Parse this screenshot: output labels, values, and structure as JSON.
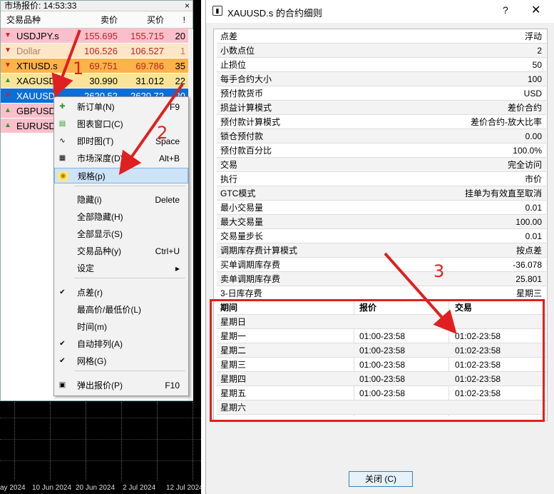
{
  "market_watch": {
    "title": "市场报价: 14:53:33",
    "close": "×",
    "headers": {
      "symbol": "交易品种",
      "bid": "卖价",
      "ask": "买价",
      "spread": "!"
    },
    "rows": [
      {
        "symbol": "USDJPY.s",
        "bid": "155.695",
        "ask": "155.715",
        "spread": "20",
        "bg": "#f9c0cc",
        "dir": "down"
      },
      {
        "symbol": "Dollar",
        "bid": "106.526",
        "ask": "106.527",
        "spread": "1",
        "bg": "#fde6c8",
        "dir": "down"
      },
      {
        "symbol": "XTIUSD.s",
        "bid": "69.751",
        "ask": "69.786",
        "spread": "35",
        "bg": "#fbb34a",
        "dir": "down"
      },
      {
        "symbol": "XAGUSD.s",
        "bid": "30.990",
        "ask": "31.012",
        "spread": "22",
        "bg": "#fce39a",
        "dir": "up"
      },
      {
        "symbol": "XAUUSD",
        "bid": "2620.52",
        "ask": "2620.72",
        "spread": "20",
        "bg": "#0b6fd6",
        "dir": "down"
      },
      {
        "symbol": "GBPUSD",
        "bid": "",
        "ask": "",
        "spread": "",
        "bg": "#f9c0cc",
        "dir": "up"
      },
      {
        "symbol": "EURUSD",
        "bid": "",
        "ask": "",
        "spread": "",
        "bg": "#f9c0cc",
        "dir": "up"
      }
    ]
  },
  "context_menu": {
    "items": [
      {
        "label": "新订单(N)",
        "shortcut": "F9",
        "icon": "new-order-icon"
      },
      {
        "label": "图表窗口(C)",
        "shortcut": "",
        "icon": "chart-window-icon"
      },
      {
        "label": "即时图(T)",
        "shortcut": "Space",
        "icon": "tick-chart-icon"
      },
      {
        "label": "市场深度(D)",
        "shortcut": "Alt+B",
        "icon": "depth-icon"
      },
      {
        "label": "规格(p)",
        "shortcut": "",
        "icon": "spec-icon"
      },
      {
        "label": "隐藏(i)",
        "shortcut": "Delete",
        "icon": ""
      },
      {
        "label": "全部隐藏(H)",
        "shortcut": "",
        "icon": ""
      },
      {
        "label": "全部显示(S)",
        "shortcut": "",
        "icon": ""
      },
      {
        "label": "交易品种(y)",
        "shortcut": "Ctrl+U",
        "icon": ""
      },
      {
        "label": "设定",
        "shortcut": "▸",
        "icon": ""
      },
      {
        "label": "点差(r)",
        "shortcut": "",
        "icon": "check-icon"
      },
      {
        "label": "最高价/最低价(L)",
        "shortcut": "",
        "icon": ""
      },
      {
        "label": "时间(m)",
        "shortcut": "",
        "icon": ""
      },
      {
        "label": "自动排列(A)",
        "shortcut": "",
        "icon": "check-icon"
      },
      {
        "label": "网格(G)",
        "shortcut": "",
        "icon": "check-icon"
      },
      {
        "label": "弹出报价(P)",
        "shortcut": "F10",
        "icon": "popup-icon"
      }
    ]
  },
  "chart_dates": [
    "ay 2024",
    "10 Jun 2024",
    "20 Jun 2024",
    "2 Jul 2024",
    "12 Jul 2024"
  ],
  "dialog": {
    "title": "XAUUSD.s 的合约细则",
    "help": "?",
    "close": "✕",
    "specs": [
      {
        "k": "点差",
        "v": "浮动"
      },
      {
        "k": "小数点位",
        "v": "2"
      },
      {
        "k": "止损位",
        "v": "50"
      },
      {
        "k": "每手合约大小",
        "v": "100"
      },
      {
        "k": "预付款货币",
        "v": "USD"
      },
      {
        "k": "损益计算模式",
        "v": "差价合约"
      },
      {
        "k": "预付款计算模式",
        "v": "差价合约-放大比率"
      },
      {
        "k": "锁仓预付款",
        "v": "0.00"
      },
      {
        "k": "预付款百分比",
        "v": "100.0%"
      },
      {
        "k": "交易",
        "v": "完全访问"
      },
      {
        "k": "执行",
        "v": "市价"
      },
      {
        "k": "GTC模式",
        "v": "挂单为有效直至取消"
      },
      {
        "k": "最小交易量",
        "v": "0.01"
      },
      {
        "k": "最大交易量",
        "v": "100.00"
      },
      {
        "k": "交易量步长",
        "v": "0.01"
      },
      {
        "k": "调期库存费计算模式",
        "v": "按点差"
      },
      {
        "k": "买单调期库存费",
        "v": "-36.078"
      },
      {
        "k": "卖单调期库存费",
        "v": "25.801"
      },
      {
        "k": "3-日库存费",
        "v": "星期三"
      }
    ],
    "schedule_headers": {
      "day": "期间",
      "quote": "报价",
      "trade": "交易"
    },
    "schedule": [
      {
        "day": "星期日",
        "quote": "",
        "trade": ""
      },
      {
        "day": "星期一",
        "quote": "01:00-23:58",
        "trade": "01:02-23:58"
      },
      {
        "day": "星期二",
        "quote": "01:00-23:58",
        "trade": "01:02-23:58"
      },
      {
        "day": "星期三",
        "quote": "01:00-23:58",
        "trade": "01:02-23:58"
      },
      {
        "day": "星期四",
        "quote": "01:00-23:58",
        "trade": "01:02-23:58"
      },
      {
        "day": "星期五",
        "quote": "01:00-23:58",
        "trade": "01:02-23:58"
      },
      {
        "day": "星期六",
        "quote": "",
        "trade": ""
      }
    ],
    "close_button": "关闭 (C)"
  },
  "annotations": {
    "n1": "1",
    "n2": "2",
    "n3": "3",
    "color": "#e02020"
  }
}
